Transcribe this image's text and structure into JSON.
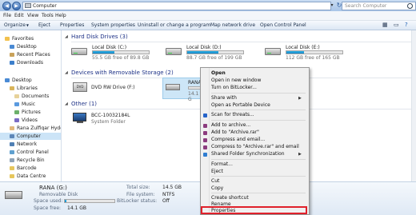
{
  "window": {
    "address": "Computer",
    "search_placeholder": "Search Computer"
  },
  "menubar": [
    "File",
    "Edit",
    "View",
    "Tools",
    "Help"
  ],
  "toolbar": {
    "organize": "Organize",
    "eject": "Eject",
    "properties": "Properties",
    "system_properties": "System properties",
    "uninstall": "Uninstall or change a program",
    "map_drive": "Map network drive",
    "control_panel": "Open Control Panel"
  },
  "nav": {
    "favorites": "Favorites",
    "desktop_fav": "Desktop",
    "recent": "Recent Places",
    "downloads": "Downloads",
    "desktop": "Desktop",
    "libraries": "Libraries",
    "documents": "Documents",
    "music": "Music",
    "pictures": "Pictures",
    "videos": "Videos",
    "user": "Rana Zulfiqar Hyder",
    "computer": "Computer",
    "network": "Network",
    "control_panel": "Control Panel",
    "recycle": "Recycle Bin",
    "barcode": "Barcode",
    "datacentre": "Data Centre"
  },
  "groups": {
    "hdd": "Hard Disk Drives (3)",
    "removable": "Devices with Removable Storage (2)",
    "other": "Other (1)"
  },
  "drives": [
    {
      "name": "Local Disk (C:)",
      "free": "55.5 GB free of 89.8 GB",
      "used": 0.38
    },
    {
      "name": "Local Disk (D:)",
      "free": "88.7 GB free of 199 GB",
      "used": 0.55
    },
    {
      "name": "Local Disk (E:)",
      "free": "112 GB free of 165 GB",
      "used": 0.32
    }
  ],
  "removable": {
    "dvd": "DVD RW Drive (F:)",
    "rana_name": "RANA",
    "rana_free": "14.1 G"
  },
  "other": {
    "name": "BCC-10032184L",
    "type": "System Folder"
  },
  "details": {
    "name": "RANA (G:)",
    "type": "Removable Disk",
    "space_used_label": "Space used:",
    "space_free_label": "Space free:",
    "space_free": "14.1 GB",
    "total_label": "Total size:",
    "total": "14.5 GB",
    "fs_label": "File system:",
    "fs": "NTFS",
    "bitlocker_label": "BitLocker status:",
    "bitlocker": "Off",
    "used_fraction": 0.03
  },
  "context_menu": {
    "open": "Open",
    "open_new_window": "Open in new window",
    "bitlocker": "Turn on BitLocker...",
    "share_with": "Share with",
    "portable": "Open as Portable Device",
    "scan": "Scan for threats...",
    "add_archive": "Add to archive...",
    "add_rar": "Add to \"Archive.rar\"",
    "compress_email": "Compress and email...",
    "compress_rar_email": "Compress to \"Archive.rar\" and email",
    "shared_sync": "Shared Folder Synchronization",
    "format": "Format...",
    "eject": "Eject",
    "cut": "Cut",
    "copy": "Copy",
    "shortcut": "Create shortcut",
    "rename": "Rename",
    "properties": "Properties"
  },
  "colors": {
    "highlight": "#e0202a",
    "bar_fill": "#2bb3ea",
    "group_header": "#1e3287"
  }
}
